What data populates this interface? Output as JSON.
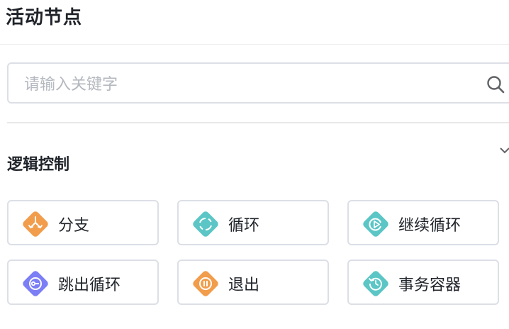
{
  "panel": {
    "title": "活动节点"
  },
  "search": {
    "placeholder": "请输入关键字",
    "value": ""
  },
  "section": {
    "title": "逻辑控制"
  },
  "colors": {
    "orange": "#f29d4b",
    "teal": "#5bc6c5",
    "purple": "#7c7ef5",
    "border": "#dcdfe6"
  },
  "nodes": [
    {
      "label": "分支",
      "icon": "branch-icon",
      "color": "#f29d4b"
    },
    {
      "label": "循环",
      "icon": "loop-icon",
      "color": "#5bc6c5"
    },
    {
      "label": "继续循环",
      "icon": "continue-loop-icon",
      "color": "#5bc6c5"
    },
    {
      "label": "跳出循环",
      "icon": "break-loop-icon",
      "color": "#7c7ef5"
    },
    {
      "label": "退出",
      "icon": "exit-icon",
      "color": "#f29d4b"
    },
    {
      "label": "事务容器",
      "icon": "transaction-icon",
      "color": "#5bc6c5"
    }
  ]
}
